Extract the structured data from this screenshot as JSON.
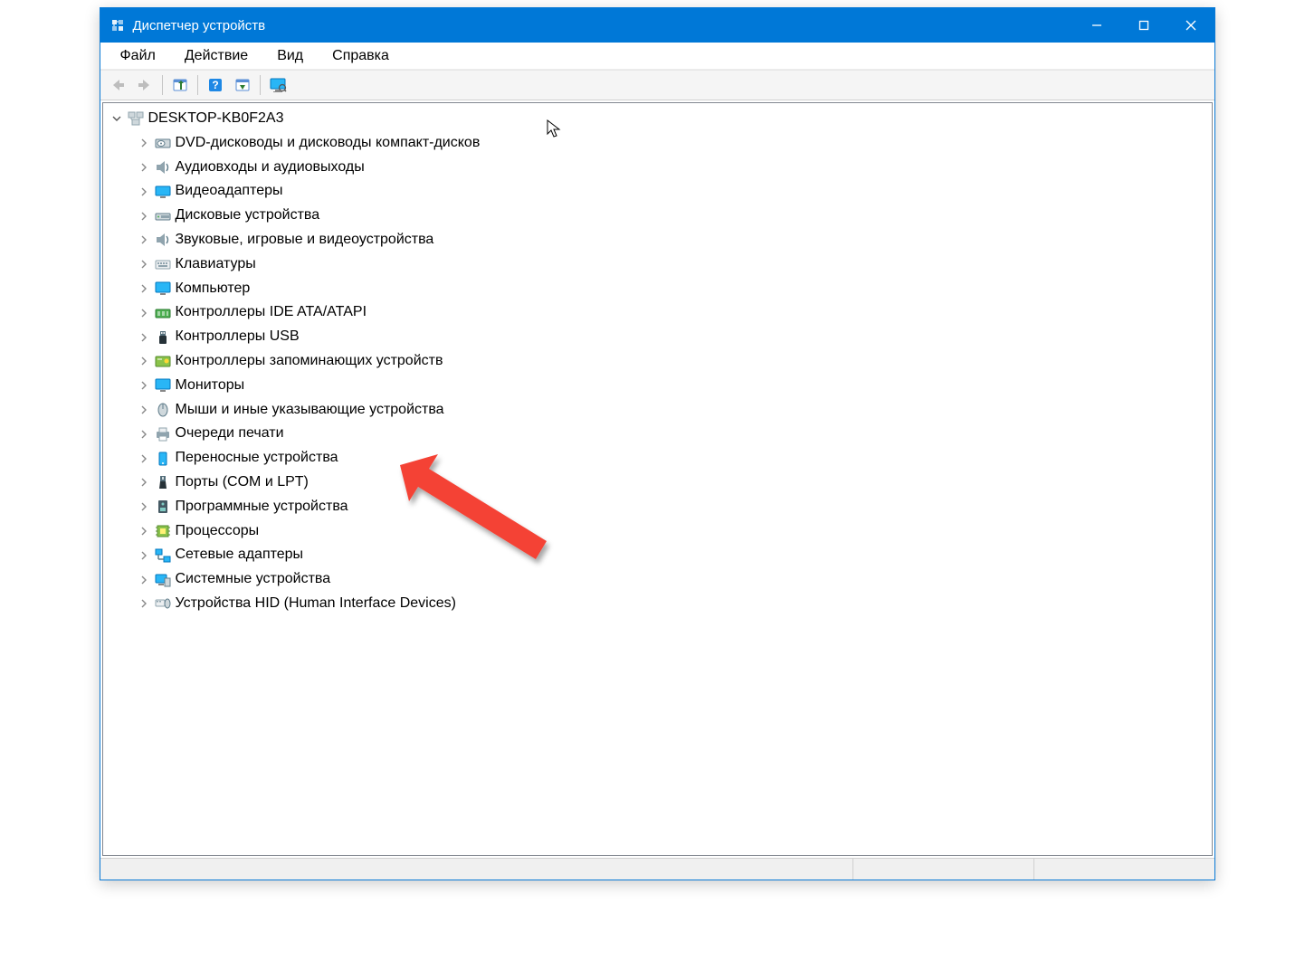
{
  "window": {
    "title": "Диспетчер устройств"
  },
  "menubar": {
    "file": "Файл",
    "action": "Действие",
    "view": "Вид",
    "help": "Справка"
  },
  "tree": {
    "root": "DESKTOP-KB0F2A3",
    "items": [
      "DVD-дисководы и дисководы компакт-дисков",
      "Аудиовходы и аудиовыходы",
      "Видеоадаптеры",
      "Дисковые устройства",
      "Звуковые, игровые и видеоустройства",
      "Клавиатуры",
      "Компьютер",
      "Контроллеры IDE ATA/ATAPI",
      "Контроллеры USB",
      "Контроллеры запоминающих устройств",
      "Мониторы",
      "Мыши и иные указывающие устройства",
      "Очереди печати",
      "Переносные устройства",
      "Порты (COM и LPT)",
      "Программные устройства",
      "Процессоры",
      "Сетевые адаптеры",
      "Системные устройства",
      "Устройства HID (Human Interface Devices)"
    ]
  },
  "icons": [
    "disc",
    "audio",
    "display",
    "hdd",
    "audio",
    "keyboard",
    "monitor",
    "ide",
    "usb",
    "storage",
    "monitor",
    "mouse",
    "printer",
    "portable",
    "ports",
    "software",
    "cpu",
    "network",
    "system",
    "hid"
  ],
  "colors": {
    "accent": "#0078d7",
    "arrow": "#f44336"
  }
}
